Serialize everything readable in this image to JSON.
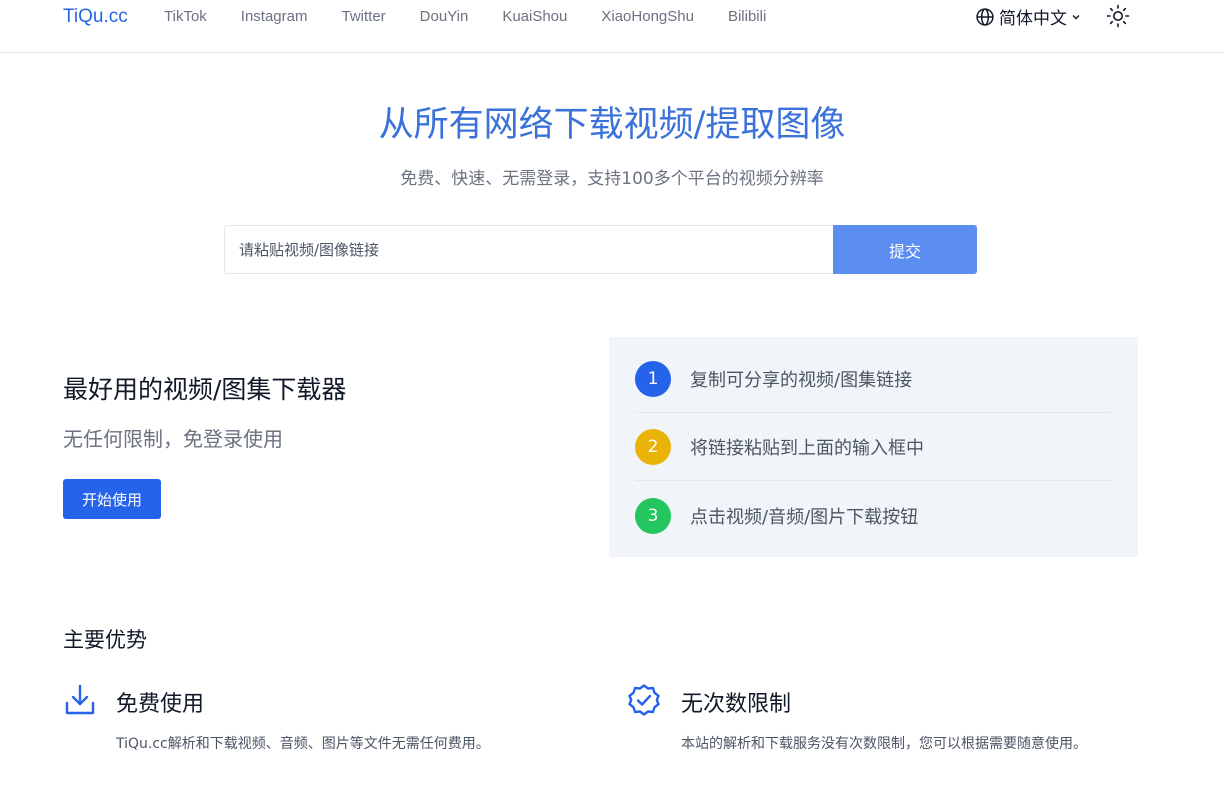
{
  "header": {
    "logo": "TiQu.cc",
    "nav": [
      "TikTok",
      "Instagram",
      "Twitter",
      "DouYin",
      "KuaiShou",
      "XiaoHongShu",
      "Bilibili"
    ],
    "language": "简体中文",
    "icons": {
      "language": "globe-icon",
      "chevron": "chevron-down-icon",
      "theme": "sun-icon"
    }
  },
  "hero": {
    "title": "从所有网络下载视频/提取图像",
    "subtitle": "免费、快速、无需登录，支持100多个平台的视频分辨率",
    "placeholder": "请粘贴视频/图像链接",
    "submit": "提交"
  },
  "feature": {
    "title": "最好用的视频/图集下载器",
    "subtitle": "无任何限制，免登录使用",
    "button": "开始使用"
  },
  "steps": [
    {
      "num": "1",
      "text": "复制可分享的视频/图集链接",
      "color": "#2563eb"
    },
    {
      "num": "2",
      "text": "将链接粘贴到上面的输入框中",
      "color": "#eab308"
    },
    {
      "num": "3",
      "text": "点击视频/音频/图片下载按钮",
      "color": "#22c55e"
    }
  ],
  "advantages": {
    "title": "主要优势",
    "items": [
      {
        "name": "免费使用",
        "desc": "TiQu.cc解析和下载视频、音频、图片等文件无需任何费用。",
        "icon": "download-icon"
      },
      {
        "name": "无次数限制",
        "desc": "本站的解析和下载服务没有次数限制，您可以根据需要随意使用。",
        "icon": "badge-check-icon"
      }
    ]
  },
  "colors": {
    "accent": "#2563eb",
    "hero_title": "#3b72d9",
    "submit": "#5b8ef0",
    "panel": "#f1f5f9"
  }
}
